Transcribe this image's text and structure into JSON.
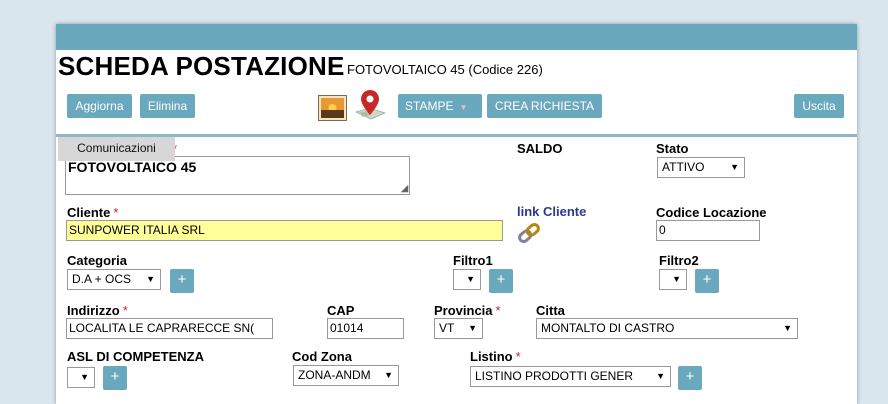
{
  "header": {
    "title": "SCHEDA POSTAZIONE",
    "subtitle": "FOTOVOLTAICO 45 (Codice 226)"
  },
  "toolbar": {
    "aggiorna": "Aggiorna",
    "elimina": "Elimina",
    "stampe": "STAMPE",
    "crea_richiesta": "CREA RICHIESTA",
    "uscita": "Uscita",
    "image_icon": "landscape-image-icon",
    "map_icon": "map-pin-icon"
  },
  "tab": {
    "label": "Comunicazioni"
  },
  "form": {
    "descrizione": {
      "value": "FOTOVOLTAICO 45"
    },
    "saldo": {
      "label": "SALDO"
    },
    "stato": {
      "label": "Stato",
      "value": "ATTIVO"
    },
    "cliente": {
      "label": "Cliente",
      "value": "SUNPOWER ITALIA SRL"
    },
    "link_cliente": {
      "label": "link Cliente",
      "icon": "chain-link-icon"
    },
    "codice_locazione": {
      "label": "Codice Locazione",
      "value": "0"
    },
    "categoria": {
      "label": "Categoria",
      "value": "D.A + OCS"
    },
    "filtro1": {
      "label": "Filtro1",
      "value": ""
    },
    "filtro2": {
      "label": "Filtro2",
      "value": ""
    },
    "indirizzo": {
      "label": "Indirizzo",
      "value": "LOCALITA LE CAPRARECCE SN("
    },
    "cap": {
      "label": "CAP",
      "value": "01014"
    },
    "provincia": {
      "label": "Provincia",
      "value": "VT"
    },
    "citta": {
      "label": "Citta",
      "value": "MONTALTO DI CASTRO"
    },
    "asl": {
      "label": "ASL DI COMPETENZA",
      "value": ""
    },
    "cod_zona": {
      "label": "Cod Zona",
      "value": "ZONA-ANDM"
    },
    "listino": {
      "label": "Listino",
      "value": "LISTINO PRODOTTI GENER"
    }
  },
  "symbols": {
    "required": "*",
    "plus": "+",
    "dropdown": "▼"
  },
  "colors": {
    "accent": "#6aa8bd",
    "required": "#d02020",
    "highlight": "#ffff99",
    "link": "#2a3a90"
  }
}
